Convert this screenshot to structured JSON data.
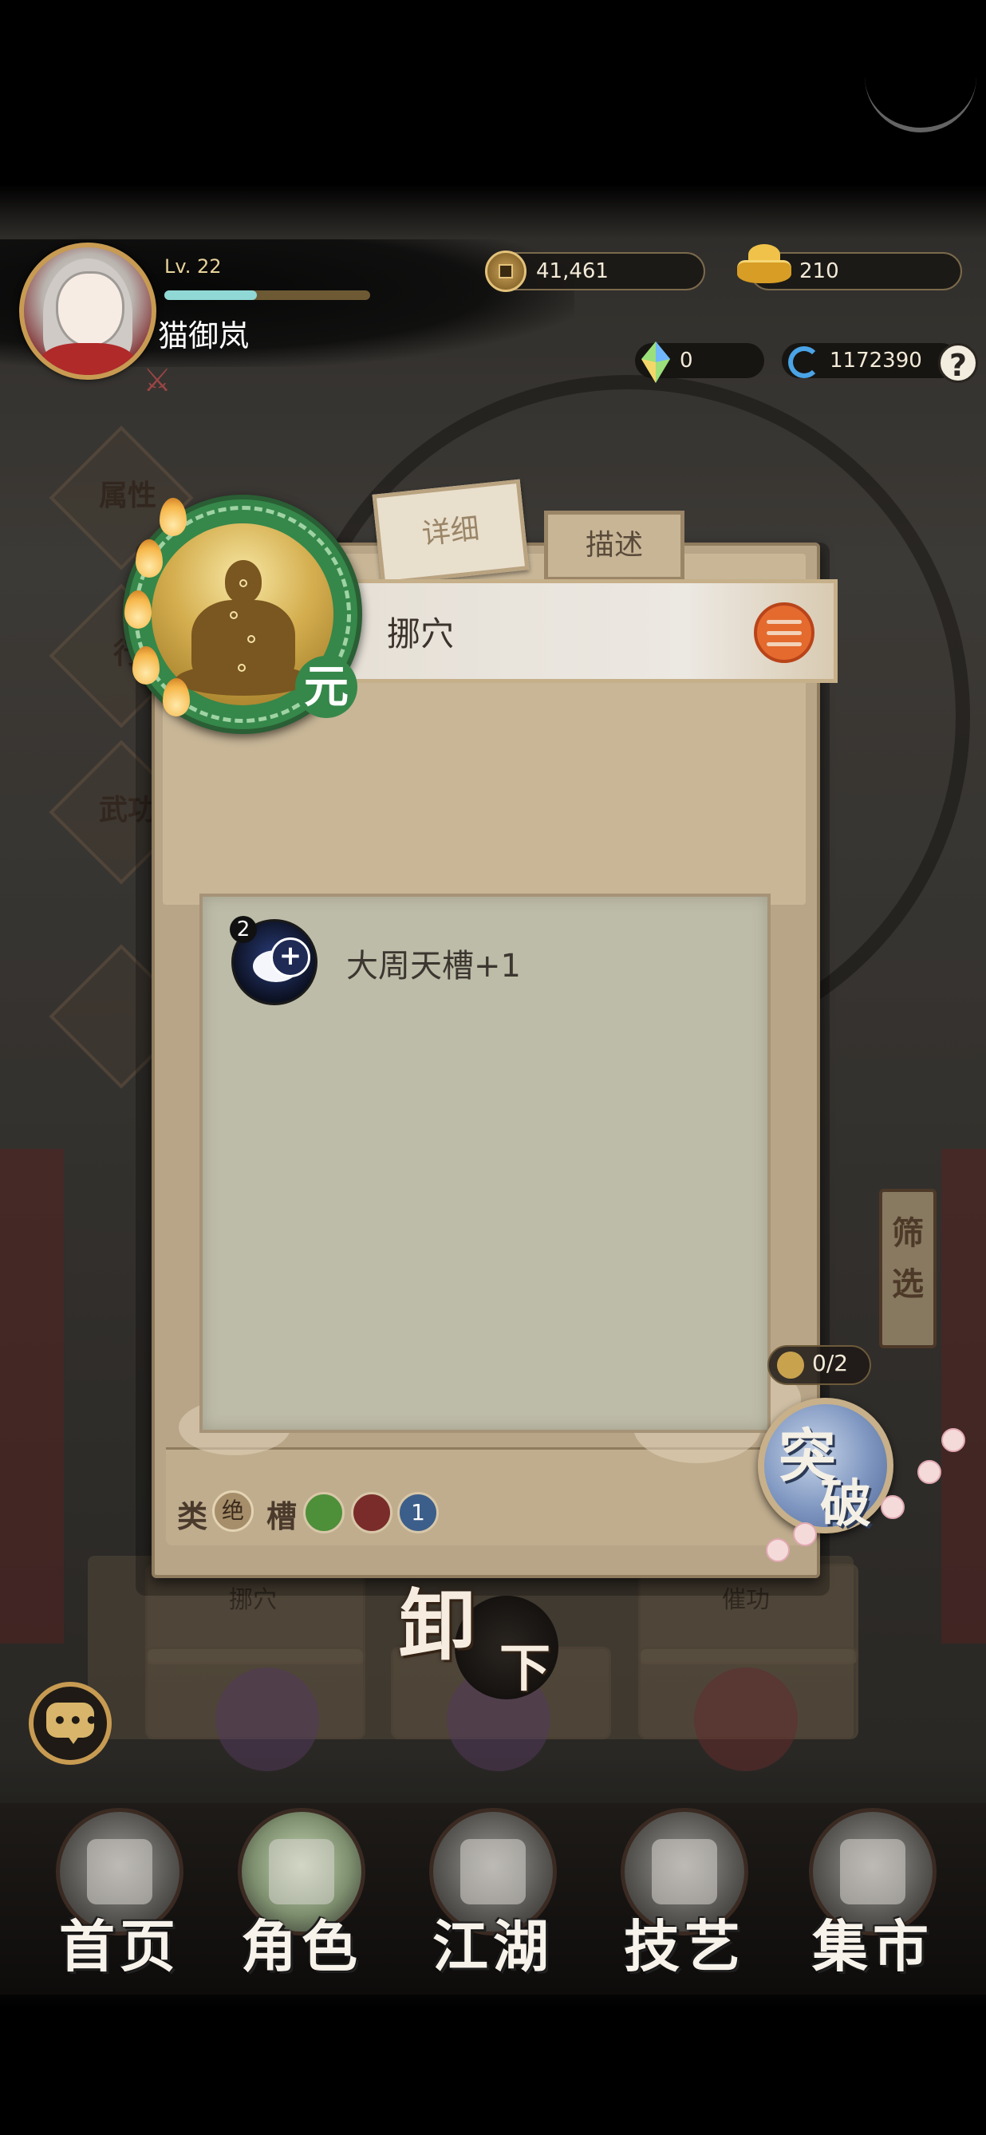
{
  "header": {
    "player_name": "猫御岚",
    "level": "Lv. 22",
    "xp_fraction": 0.45,
    "coins": "41,461",
    "ingots": "210",
    "gems": "0",
    "energy": "1172390",
    "help_label": "?"
  },
  "popup": {
    "tabs": [
      {
        "label": "详细",
        "active": true
      },
      {
        "label": "描述",
        "active": false
      }
    ],
    "skill_name": "挪穴",
    "emblem_badge": "元",
    "effect": {
      "count": "2",
      "text": "大周天槽+1"
    },
    "info": {
      "type_label": "类",
      "type_value": "绝",
      "slot_label": "槽",
      "slot_badges": [
        {
          "color": "#4e8f3a",
          "text": ""
        },
        {
          "color": "#7a2c2a",
          "text": ""
        },
        {
          "color": "#3c5e8a",
          "text": "1"
        }
      ]
    },
    "unequip": {
      "main": "卸",
      "sub": "下"
    }
  },
  "breakthrough": {
    "counter": "0/2",
    "line1": "突",
    "line2": "破"
  },
  "background": {
    "diamond_labels": [
      "属性",
      "行",
      "武功"
    ],
    "filter_tag": "筛选",
    "slot_labels": [
      "挪穴",
      "催功"
    ]
  },
  "nav": [
    {
      "label": "首页",
      "icon": "home-pavilion-icon"
    },
    {
      "label": "角色",
      "icon": "character-icon"
    },
    {
      "label": "江湖",
      "icon": "mountain-icon"
    },
    {
      "label": "技艺",
      "icon": "crafting-icon"
    },
    {
      "label": "集市",
      "icon": "market-bag-icon"
    }
  ],
  "colors": {
    "accent_gold": "#c89b52",
    "panel_parchment": "#b8a588",
    "emblem_green": "#36874a",
    "seal_orange": "#e46a2e"
  }
}
